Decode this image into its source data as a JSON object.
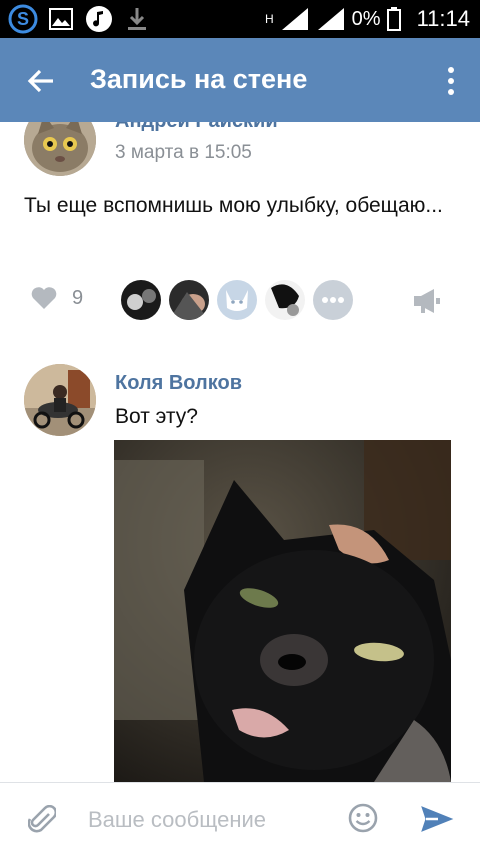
{
  "status_bar": {
    "network_label": "H",
    "battery": "0%",
    "time": "11:14",
    "icons": [
      "s-app-icon",
      "gallery-icon",
      "music-icon",
      "download-icon",
      "signal-icon",
      "battery-icon"
    ]
  },
  "app_bar": {
    "title": "Запись на стене",
    "icons": [
      "back-arrow-icon",
      "more-vertical-icon"
    ]
  },
  "post": {
    "author": "Андрей Райский",
    "date": "3 марта в 15:05",
    "text": "Ты еще вспомнишь мою улыбку, обещаю...",
    "likes_count": "9",
    "liker_avatars": 4,
    "icons": [
      "heart-icon",
      "more-likers-icon",
      "share-megaphone-icon"
    ]
  },
  "comment": {
    "author": "Коля Волков",
    "text": "Вот эту?",
    "photo": "black cat photo"
  },
  "composer": {
    "placeholder": "Ваше сообщение",
    "icons": [
      "paperclip-icon",
      "emoji-icon",
      "send-icon"
    ]
  },
  "colors": {
    "app_bar": "#5b87b9",
    "author_link": "#4e74a0",
    "secondary_text": "#8a8f95",
    "send_icon": "#5181b8"
  }
}
